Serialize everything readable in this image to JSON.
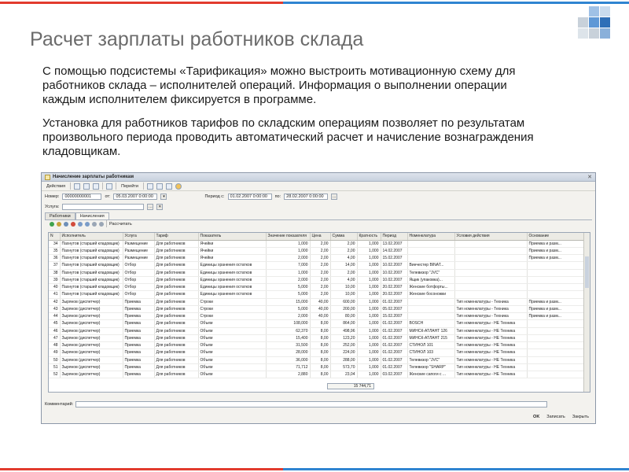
{
  "slide": {
    "title": "Расчет зарплаты работников склада",
    "paragraph1": "С помощью подсистемы «Тарификация» можно выстроить мотивационную схему для работников склада – исполнителей операций. Информация о выполнении операции каждым исполнителем фиксируется в программе.",
    "paragraph2": "Установка для работников тарифов по складским операциям позволяет по результатам произвольного периода проводить автоматический расчет и начисление вознаграждения кладовщикам."
  },
  "colors": {
    "accent_red": "#e23b2e",
    "accent_blue": "#2f84d1"
  },
  "window": {
    "title": "Начисление зарплаты работникам",
    "toolbar": {
      "actions": "Действия",
      "goto": "Перейти"
    },
    "form": {
      "number_label": "Номер:",
      "number_value": "00000000001",
      "from_label": "от:",
      "from_value": "05.03.2007 0:00:00",
      "period_label": "Период с:",
      "period_from": "01.02.2007 0:00:00",
      "period_to_label": "по:",
      "period_to": "28.02.2007 0:00:00",
      "service_label": "Услуга:",
      "service_value": ""
    },
    "tabs": [
      "Работники",
      "Начисления"
    ],
    "calc_label": "Рассчитать",
    "columns": [
      "N",
      "Исполнитель",
      "Услуга",
      "Тариф",
      "Показатель",
      "Значение показателя",
      "Цена",
      "Сумма",
      "Кратность",
      "Период",
      "Номенклатура",
      "Условия действия",
      "Основание"
    ],
    "rows": [
      [
        "34",
        "Пахнутов (старший кладовщик)",
        "Размещение",
        "Для работников",
        "Ячейки",
        "1,000",
        "2,00",
        "2,00",
        "1,000",
        "13.02.2007",
        "",
        "",
        "Приемка и разм..."
      ],
      [
        "35",
        "Пахнутов (старший кладовщик)",
        "Размещение",
        "Для работников",
        "Ячейки",
        "1,000",
        "2,00",
        "2,00",
        "1,000",
        "14.02.2007",
        "",
        "",
        "Приемка и разм..."
      ],
      [
        "36",
        "Пахнутов (старший кладовщик)",
        "Размещение",
        "Для работников",
        "Ячейки",
        "2,000",
        "2,00",
        "4,00",
        "1,000",
        "15.02.2007",
        "",
        "",
        "Приемка и разм..."
      ],
      [
        "37",
        "Пахнутов (старший кладовщик)",
        "Отбор",
        "Для работников",
        "Единицы хранения остатков",
        "7,000",
        "2,00",
        "14,00",
        "1,000",
        "10.02.2007",
        "Винчестер BINAT...",
        "",
        ""
      ],
      [
        "38",
        "Пахнутов (старший кладовщик)",
        "Отбор",
        "Для работников",
        "Единицы хранения остатков",
        "1,000",
        "2,00",
        "2,00",
        "1,000",
        "10.02.2007",
        "Телевизор \"JVC\"",
        "",
        ""
      ],
      [
        "39",
        "Пахнутов (старший кладовщик)",
        "Отбор",
        "Для работников",
        "Единицы хранения остатков",
        "2,000",
        "2,00",
        "4,00",
        "1,000",
        "10.02.2007",
        "Ящик (упаковка)...",
        "",
        ""
      ],
      [
        "40",
        "Пахнутов (старший кладовщик)",
        "Отбор",
        "Для работников",
        "Единицы хранения остатков",
        "5,000",
        "2,00",
        "10,00",
        "1,000",
        "20.02.2007",
        "Женские ботфорты...",
        "",
        ""
      ],
      [
        "41",
        "Пахнутов (старший кладовщик)",
        "Отбор",
        "Для работников",
        "Единицы хранения остатков",
        "5,000",
        "2,00",
        "10,00",
        "1,000",
        "20.02.2007",
        "Женские босоножки",
        "",
        ""
      ],
      [
        "42",
        "Зырянов (диспетчер)",
        "Приемка",
        "Для работников",
        "Строки",
        "15,000",
        "40,00",
        "600,00",
        "1,000",
        "01.02.2007",
        "",
        "Тип номенклатуры - Техника",
        "Приемка и разм..."
      ],
      [
        "43",
        "Зырянов (диспетчер)",
        "Приемка",
        "Для работников",
        "Строки",
        "5,000",
        "40,00",
        "200,00",
        "1,000",
        "05.02.2007",
        "",
        "Тип номенклатуры - Техника",
        "Приемка и разм..."
      ],
      [
        "44",
        "Зырянов (диспетчер)",
        "Приемка",
        "Для работников",
        "Строки",
        "2,000",
        "40,00",
        "80,00",
        "1,000",
        "15.02.2007",
        "",
        "Тип номенклатуры - Техника",
        "Приемка и разм..."
      ],
      [
        "45",
        "Зырянов (диспетчер)",
        "Приемка",
        "Для работников",
        "Объем",
        "108,000",
        "8,00",
        "864,00",
        "1,000",
        "01.02.2007",
        "BOSCH",
        "Тип номенклатуры - НЕ Техника",
        ""
      ],
      [
        "46",
        "Зырянов (диспетчер)",
        "Приемка",
        "Для работников",
        "Объем",
        "62,370",
        "8,00",
        "498,96",
        "1,000",
        "01.02.2007",
        "МИНСК-АТЛАНТ 126",
        "Тип номенклатуры - НЕ Техника",
        ""
      ],
      [
        "47",
        "Зырянов (диспетчер)",
        "Приемка",
        "Для работников",
        "Объем",
        "15,400",
        "8,00",
        "123,20",
        "1,000",
        "01.02.2007",
        "МИНСК-АТЛАНТ 215",
        "Тип номенклатуры - НЕ Техника",
        ""
      ],
      [
        "48",
        "Зырянов (диспетчер)",
        "Приемка",
        "Для работников",
        "Объем",
        "31,500",
        "8,00",
        "252,00",
        "1,000",
        "01.02.2007",
        "СТИНОЛ 101",
        "Тип номенклатуры - НЕ Техника",
        ""
      ],
      [
        "49",
        "Зырянов (диспетчер)",
        "Приемка",
        "Для работников",
        "Объем",
        "28,000",
        "8,00",
        "224,00",
        "1,000",
        "01.02.2007",
        "СТИНОЛ 103",
        "Тип номенклатуры - НЕ Техника",
        ""
      ],
      [
        "50",
        "Зырянов (диспетчер)",
        "Приемка",
        "Для работников",
        "Объем",
        "36,000",
        "8,00",
        "288,00",
        "1,000",
        "01.02.2007",
        "Телевизор \"JVC\"",
        "Тип номенклатуры - НЕ Техника",
        ""
      ],
      [
        "51",
        "Зырянов (диспетчер)",
        "Приемка",
        "Для работников",
        "Объем",
        "71,712",
        "8,00",
        "573,70",
        "1,000",
        "01.02.2007",
        "Телевизор \"SHARP\"",
        "Тип номенклатуры - НЕ Техника",
        ""
      ],
      [
        "52",
        "Зырянов (диспетчер)",
        "Приемка",
        "Для работников",
        "Объем",
        "2,880",
        "8,00",
        "23,04",
        "1,000",
        "03.02.2007",
        "Женские сапоги с ...",
        "Тип номенклатуры - НЕ Техника",
        ""
      ]
    ],
    "total": "15 744,71",
    "comment_label": "Комментарий:",
    "buttons": {
      "ok": "OK",
      "save": "Записать",
      "close": "Закрыть"
    }
  }
}
